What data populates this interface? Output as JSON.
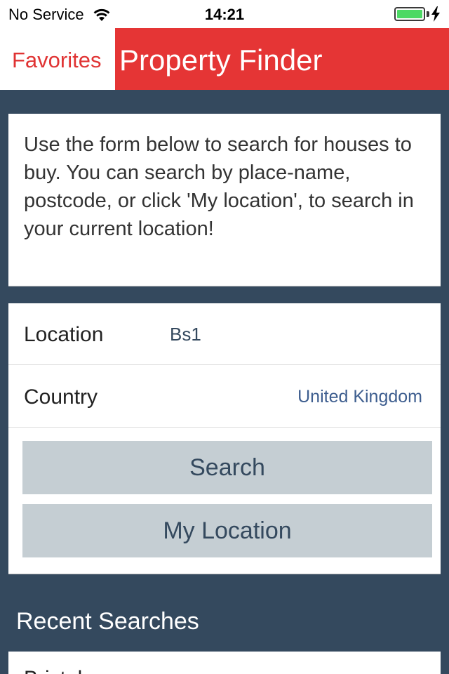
{
  "status_bar": {
    "carrier": "No Service",
    "time": "14:21",
    "battery_color": "#4cd964"
  },
  "nav": {
    "back_label": "Favorites",
    "title": "Property Finder",
    "accent": "#e53535"
  },
  "info": {
    "text": "Use the form below to search for houses to buy. You can search by place-name, postcode, or click 'My location', to search in your current location!"
  },
  "form": {
    "location_label": "Location",
    "location_value": "Bs1",
    "country_label": "Country",
    "country_value": "United Kingdom",
    "search_button": "Search",
    "my_location_button": "My Location"
  },
  "recent": {
    "heading": "Recent Searches",
    "items": [
      "Bristol"
    ]
  },
  "colors": {
    "background": "#34495e",
    "button": "#c5ced3"
  }
}
